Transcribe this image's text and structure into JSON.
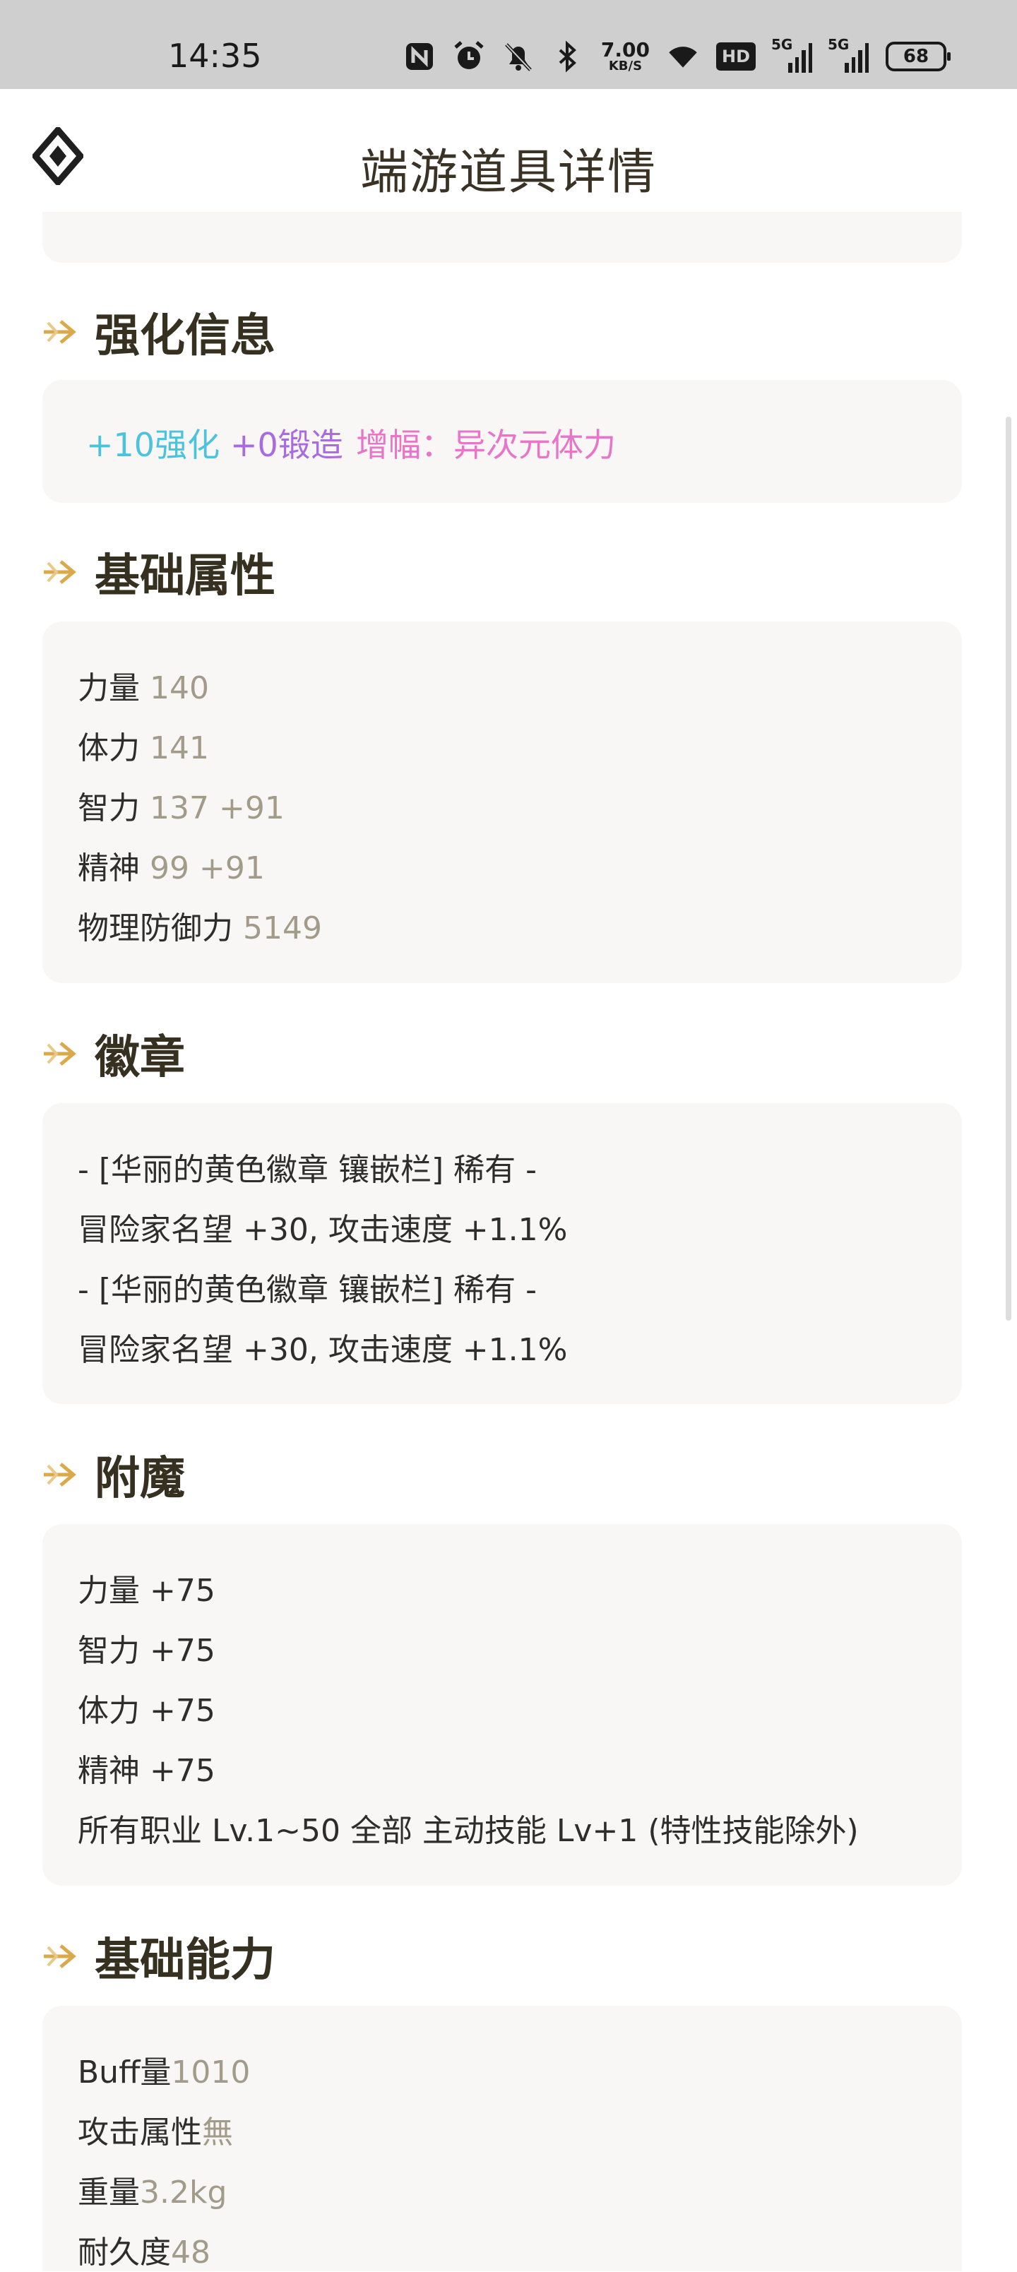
{
  "status": {
    "time": "14:35",
    "net_speed_value": "7.00",
    "net_speed_unit": "KB/S",
    "hd_label": "HD",
    "signal1_label": "5G",
    "signal2_label": "5G",
    "battery": "68",
    "icons": [
      "nfc-icon",
      "alarm-icon",
      "mute-icon",
      "bluetooth-icon",
      "wifi-icon"
    ]
  },
  "header": {
    "title": "端游道具详情"
  },
  "enhance": {
    "heading": "强化信息",
    "refine": "+10强化",
    "forge": "+0锻造",
    "amplify": "增幅：异次元体力",
    "colors": {
      "refine": "#4cc3dd",
      "forge": "#a86be0",
      "amplify": "#e875c8"
    }
  },
  "base_attrs": {
    "heading": "基础属性",
    "rows": [
      {
        "name": "力量",
        "value": "140"
      },
      {
        "name": "体力",
        "value": "141"
      },
      {
        "name": "智力",
        "value": "137 +91"
      },
      {
        "name": "精神",
        "value": "99 +91"
      },
      {
        "name": "物理防御力",
        "value": "5149"
      }
    ]
  },
  "emblem": {
    "heading": "徽章",
    "lines": [
      "- [华丽的黄色徽章 镶嵌栏] 稀有 -",
      "冒险家名望 +30, 攻击速度 +1.1%",
      "- [华丽的黄色徽章 镶嵌栏] 稀有 -",
      "冒险家名望 +30, 攻击速度 +1.1%"
    ]
  },
  "enchant": {
    "heading": "附魔",
    "lines": [
      "力量 +75",
      "智力 +75",
      "体力 +75",
      "精神 +75",
      "所有职业 Lv.1~50 全部 主动技能 Lv+1 (特性技能除外)"
    ]
  },
  "base_ability": {
    "heading": "基础能力",
    "rows": [
      {
        "name": "Buff量",
        "value": "1010"
      },
      {
        "name": "攻击属性",
        "value": "無"
      },
      {
        "name": "重量",
        "value": "3.2kg"
      },
      {
        "name": "耐久度",
        "value": "48"
      }
    ]
  },
  "theme": {
    "accent": "#d9a94a",
    "card_bg": "#f8f7f5",
    "value_color": "#a39b89"
  }
}
